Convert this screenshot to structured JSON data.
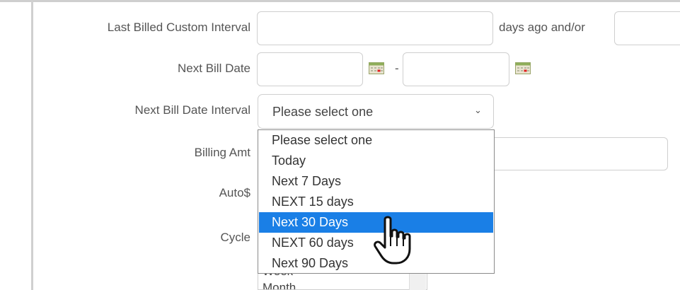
{
  "form": {
    "last_billed_custom_interval_label": "Last Billed Custom Interval",
    "days_ago_text": "days ago and/or",
    "next_bill_date_label": "Next Bill Date",
    "date_range_separator": "-",
    "next_bill_date_interval_label": "Next Bill Date Interval",
    "billing_amt_label": "Billing Amt",
    "auto_label": "Auto$",
    "cycle_label": "Cycle"
  },
  "interval_select": {
    "selected_value": "Please select one",
    "options": [
      "Please select one",
      "Today",
      "Next 7 Days",
      "NEXT 15 days",
      "Next 30 Days",
      "NEXT 60 days",
      "Next 90 Days"
    ],
    "highlighted_option": "Next 30 Days"
  },
  "cycle_list": {
    "visible_items": [
      "Week",
      "Month"
    ]
  },
  "colors": {
    "highlight": "#1a7fe6",
    "border": "#cfcfcf"
  }
}
